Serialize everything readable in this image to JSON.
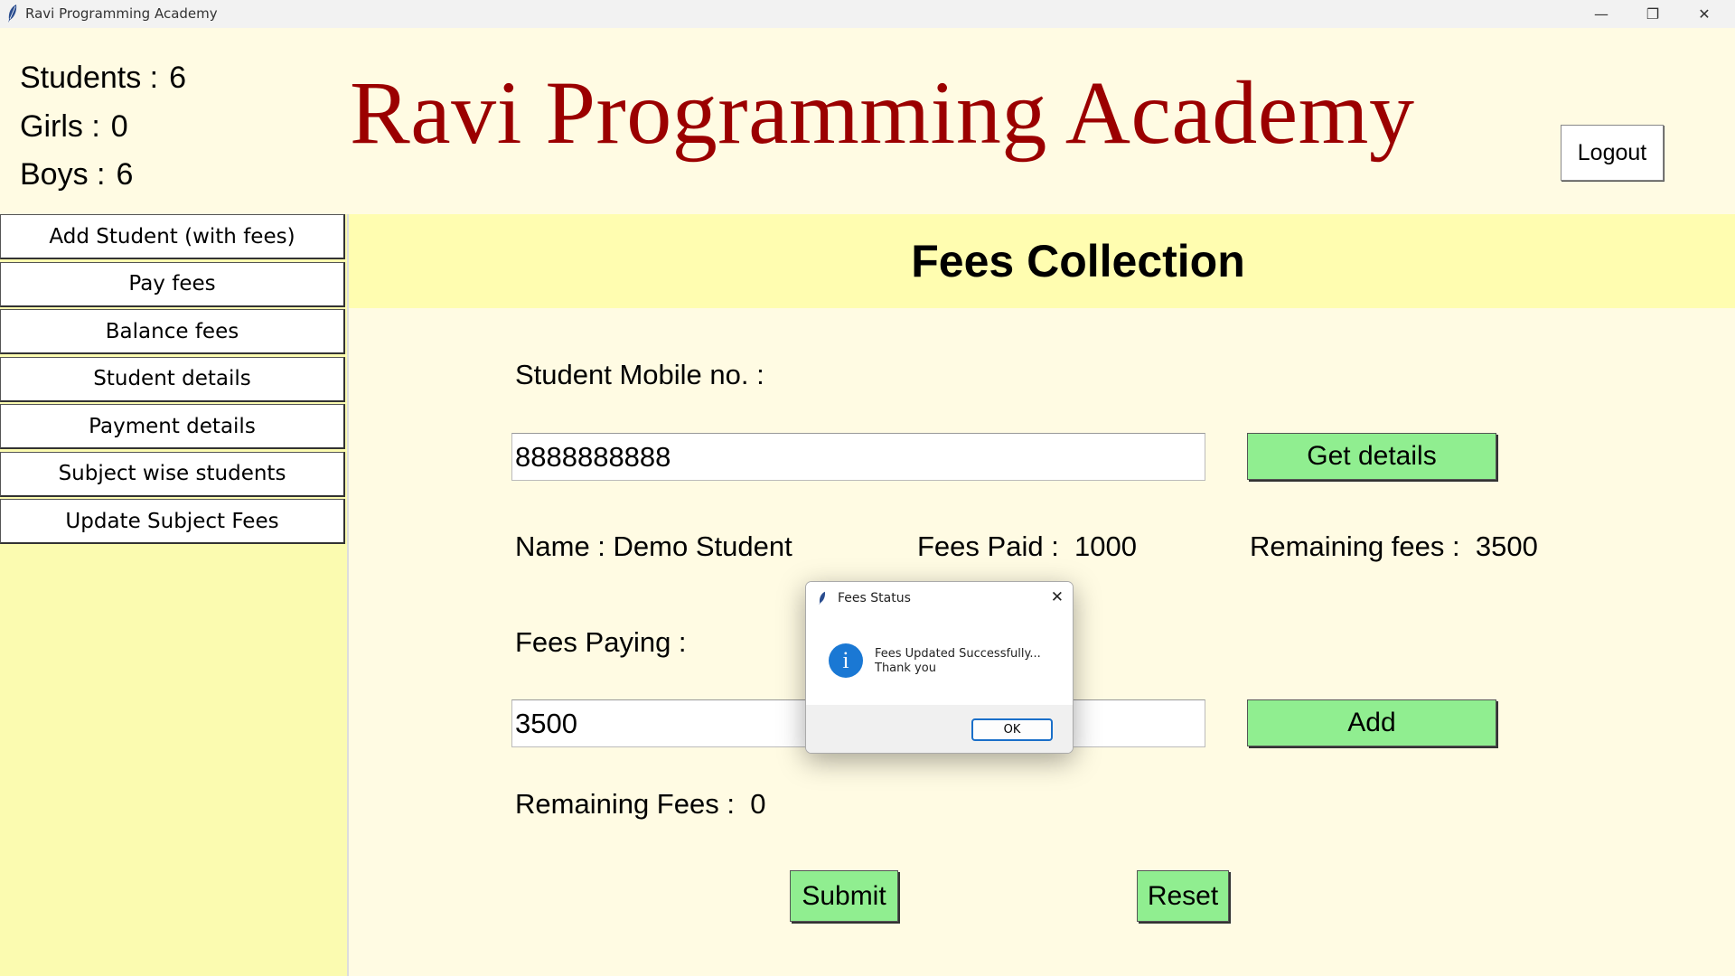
{
  "window": {
    "title": "Ravi Programming Academy",
    "minimize": "—",
    "restore": "❐",
    "close": "✕"
  },
  "stats": {
    "students_label": "Students :",
    "students_value": "6",
    "girls_label": "Girls :",
    "girls_value": "0",
    "boys_label": "Boys :",
    "boys_value": "6"
  },
  "header": {
    "title": "Ravi Programming Academy",
    "logout": "Logout"
  },
  "sidebar": {
    "items": [
      {
        "label": "Add Student (with fees)"
      },
      {
        "label": "Pay fees"
      },
      {
        "label": "Balance fees"
      },
      {
        "label": "Student details"
      },
      {
        "label": "Payment details"
      },
      {
        "label": "Subject wise students"
      },
      {
        "label": "Update Subject Fees"
      }
    ]
  },
  "main": {
    "heading": "Fees Collection",
    "mobile_label": "Student Mobile no.   :",
    "mobile_value": "8888888888",
    "get_details": "Get details",
    "name_text": "Name : Demo Student",
    "fees_paid_label": "Fees Paid :",
    "fees_paid_value": "1000",
    "remaining_label": "Remaining fees :",
    "remaining_value": "3500",
    "fees_paying_label": "Fees Paying :",
    "fees_paying_value": "3500",
    "add": "Add",
    "remaining_fees_label": "Remaining Fees :",
    "remaining_fees_value": "0",
    "submit": "Submit",
    "reset": "Reset"
  },
  "dialog": {
    "title": "Fees Status",
    "close": "✕",
    "icon": "info-icon",
    "line1": "Fees Updated Successfully...",
    "line2": "Thank you",
    "ok": "OK"
  }
}
